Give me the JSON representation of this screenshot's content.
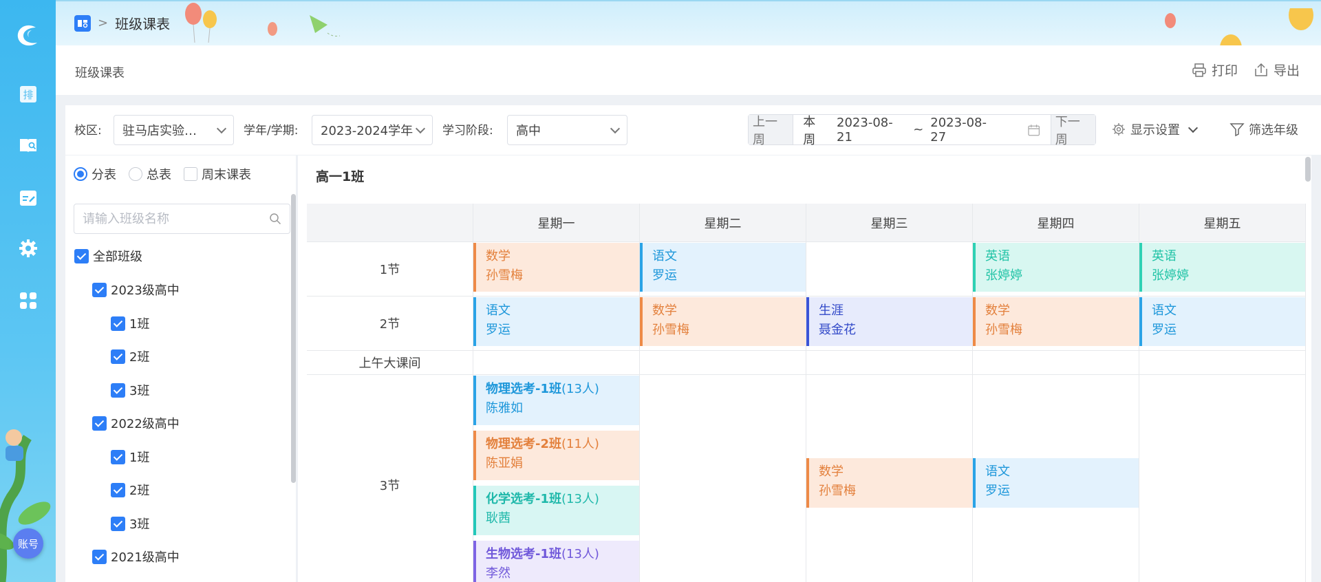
{
  "rail": {
    "icons": [
      "app-logo",
      "schedule-icon",
      "class-timetable-icon",
      "edit-icon",
      "settings-icon",
      "apps-icon"
    ],
    "schedule_glyph": "排",
    "account_label": "账号"
  },
  "breadcrumb": {
    "separator": ">",
    "current": "班级课表"
  },
  "page": {
    "title": "班级课表",
    "print_label": "打印",
    "export_label": "导出"
  },
  "filters": {
    "campus_label": "校区:",
    "campus_value": "驻马店实验…",
    "term_label": "学年/学期:",
    "term_value": "2023-2024学年",
    "stage_label": "学习阶段:",
    "stage_value": "高中",
    "prev_week": "上一周",
    "this_week": "本周",
    "start_date": "2023-08-21",
    "range_sep": "~",
    "end_date": "2023-08-27",
    "next_week": "下一周",
    "display_settings": "显示设置",
    "filter_grade": "筛选年级"
  },
  "tree": {
    "modes": [
      {
        "label": "分表",
        "selected": true
      },
      {
        "label": "总表",
        "selected": false
      },
      {
        "label": "周末课表",
        "checkbox": true,
        "checked": false
      }
    ],
    "search_placeholder": "请输入班级名称",
    "nodes": [
      {
        "label": "全部班级",
        "level": 0,
        "checked": true
      },
      {
        "label": "2023级高中",
        "level": 1,
        "checked": true
      },
      {
        "label": "1班",
        "level": 2,
        "checked": true
      },
      {
        "label": "2班",
        "level": 2,
        "checked": true
      },
      {
        "label": "3班",
        "level": 2,
        "checked": true
      },
      {
        "label": "2022级高中",
        "level": 1,
        "checked": true
      },
      {
        "label": "1班",
        "level": 2,
        "checked": true
      },
      {
        "label": "2班",
        "level": 2,
        "checked": true
      },
      {
        "label": "3班",
        "level": 2,
        "checked": true
      },
      {
        "label": "2021级高中",
        "level": 1,
        "checked": true
      }
    ]
  },
  "timetable": {
    "class_name": "高一1班",
    "days": [
      "星期一",
      "星期二",
      "星期三",
      "星期四",
      "星期五"
    ],
    "rows": [
      "1节",
      "2节",
      "上午大课间",
      "3节"
    ],
    "cells": {
      "r1": [
        {
          "subject": "数学",
          "teacher": "孙雪梅",
          "color": "orange"
        },
        {
          "subject": "语文",
          "teacher": "罗运",
          "color": "blue"
        },
        null,
        {
          "subject": "英语",
          "teacher": "张婷婷",
          "color": "teal"
        },
        {
          "subject": "英语",
          "teacher": "张婷婷",
          "color": "teal"
        }
      ],
      "r2": [
        {
          "subject": "语文",
          "teacher": "罗运",
          "color": "blue"
        },
        {
          "subject": "数学",
          "teacher": "孙雪梅",
          "color": "orange"
        },
        {
          "subject": "生涯",
          "teacher": "聂金花",
          "color": "indigo"
        },
        {
          "subject": "数学",
          "teacher": "孙雪梅",
          "color": "orange"
        },
        {
          "subject": "语文",
          "teacher": "罗运",
          "color": "blue"
        }
      ],
      "r3_mon": [
        {
          "subject": "物理选考-1班",
          "count": "(13人)",
          "teacher": "陈雅如",
          "color": "blue"
        },
        {
          "subject": "物理选考-2班",
          "count": "(11人)",
          "teacher": "陈亚娟",
          "color": "orange"
        },
        {
          "subject": "化学选考-1班",
          "count": "(13人)",
          "teacher": "耿茜",
          "color": "cyan"
        },
        {
          "subject": "生物选考-1班",
          "count": "(13人)",
          "teacher": "李然",
          "color": "violet"
        }
      ],
      "r3_wed": {
        "subject": "数学",
        "teacher": "孙雪梅",
        "color": "orange"
      },
      "r3_thu": {
        "subject": "语文",
        "teacher": "罗运",
        "color": "blue"
      }
    }
  }
}
